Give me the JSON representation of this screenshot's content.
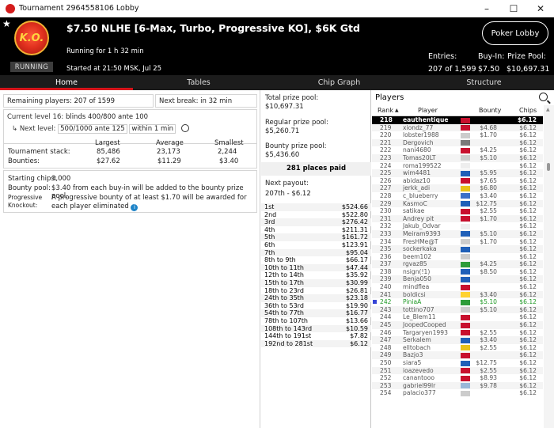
{
  "window": {
    "title": "Tournament 2964558106 Lobby"
  },
  "header": {
    "logo_text": "K.O.",
    "status_badge": "RUNNING",
    "title": "$7.50 NLHE [6-Max, Turbo, Progressive KO], $6K Gtd",
    "running_for": "Running for 1 h 32 min",
    "started_at": "Started at 21:50 MSK, Jul 25",
    "poker_lobby_label": "Poker Lobby",
    "entries_label": "Entries:",
    "entries_value": "207 of 1,599",
    "buyin_label": "Buy-In:",
    "buyin_value": "$7.50",
    "prizepool_label": "Prize Pool:",
    "prizepool_value": "$10,697.31"
  },
  "tabs": [
    "Home",
    "Tables",
    "Chip Graph",
    "Structure"
  ],
  "home": {
    "remaining": "Remaining players: 207 of 1599",
    "next_break": "Next break: in 32 min",
    "current_level_label": "Current level 16:",
    "current_level": "blinds 400/800 ante 100",
    "next_level_label": "Next level:",
    "next_level": "500/1000 ante 125",
    "next_level_time": "within 1 min",
    "stats_headers": [
      "Largest",
      "Average",
      "Smallest"
    ],
    "stack_label": "Tournament stack:",
    "stack": [
      "85,486",
      "23,173",
      "2,244"
    ],
    "bounty_label": "Bounties:",
    "bounty": [
      "$27.62",
      "$11.29",
      "$3.40"
    ],
    "starting_chips_label": "Starting chips:",
    "starting_chips": "3,000",
    "bounty_pool_label": "Bounty pool:",
    "bounty_pool": "$3.40 from each buy-in will be added to the bounty prize pool.",
    "progressive_label1": "Progressive",
    "progressive_label2": "Knockout:",
    "progressive_text": "A progressive bounty of at least $1.70 will be awarded for each player eliminated"
  },
  "prizes": {
    "total_label": "Total prize pool:",
    "total": "$10,697.31",
    "regular_label": "Regular prize pool:",
    "regular": "$5,260.71",
    "bounty_label": "Bounty prize pool:",
    "bounty": "$5,436.60",
    "places_paid": "281 places paid",
    "next_payout_label": "Next payout:",
    "next_payout": "207th - $6.12",
    "table": [
      [
        "1st",
        "$524.66"
      ],
      [
        "2nd",
        "$522.80"
      ],
      [
        "3rd",
        "$276.42"
      ],
      [
        "4th",
        "$211.31"
      ],
      [
        "5th",
        "$161.72"
      ],
      [
        "6th",
        "$123.91"
      ],
      [
        "7th",
        "$95.04"
      ],
      [
        "8th to 9th",
        "$66.17"
      ],
      [
        "10th to 11th",
        "$47.44"
      ],
      [
        "12th to 14th",
        "$35.92"
      ],
      [
        "15th to 17th",
        "$30.99"
      ],
      [
        "18th to 23rd",
        "$26.81"
      ],
      [
        "24th to 35th",
        "$23.18"
      ],
      [
        "36th to 53rd",
        "$19.90"
      ],
      [
        "54th to 77th",
        "$16.77"
      ],
      [
        "78th to 107th",
        "$13.66"
      ],
      [
        "108th to 143rd",
        "$10.59"
      ],
      [
        "144th to 191st",
        "$7.82"
      ],
      [
        "192nd to 281st",
        "$6.12"
      ]
    ]
  },
  "players": {
    "title": "Players",
    "columns": [
      "Rank",
      "Player",
      "Bounty",
      "Chips"
    ],
    "rows": [
      [
        "218",
        "eauthentique",
        "",
        "$6.12"
      ],
      [
        "219",
        "xiondz_77",
        "$4.68",
        "$6.12"
      ],
      [
        "220",
        "lobster1988",
        "$1.70",
        "$6.12"
      ],
      [
        "221",
        "Dergovich",
        "",
        "$6.12"
      ],
      [
        "222",
        "nani4680",
        "$4.25",
        "$6.12"
      ],
      [
        "223",
        "Tomas20LT",
        "$5.10",
        "$6.12"
      ],
      [
        "224",
        "roma199522",
        "",
        "$6.12"
      ],
      [
        "225",
        "wim4481",
        "$5.95",
        "$6.12"
      ],
      [
        "226",
        "abidaz10",
        "$7.65",
        "$6.12"
      ],
      [
        "227",
        "jerkk_adi",
        "$6.80",
        "$6.12"
      ],
      [
        "228",
        "c_blueberry",
        "$3.40",
        "$6.12"
      ],
      [
        "229",
        "KasmoC",
        "$12.75",
        "$6.12"
      ],
      [
        "230",
        "satikae",
        "$2.55",
        "$6.12"
      ],
      [
        "231",
        "Andrey pit",
        "$1.70",
        "$6.12"
      ],
      [
        "232",
        "Jakub_Odvar",
        "",
        "$6.12"
      ],
      [
        "233",
        "Meiram9393",
        "$5.10",
        "$6.12"
      ],
      [
        "234",
        "FresHMe@T",
        "$1.70",
        "$6.12"
      ],
      [
        "235",
        "sockerkaka",
        "",
        "$6.12"
      ],
      [
        "236",
        "beem102",
        "",
        "$6.12"
      ],
      [
        "237",
        "rgvaz85",
        "$4.25",
        "$6.12"
      ],
      [
        "238",
        "nsign(!1)",
        "$8.50",
        "$6.12"
      ],
      [
        "239",
        "Benja050",
        "",
        "$6.12"
      ],
      [
        "240",
        "mindflea",
        "",
        "$6.12"
      ],
      [
        "241",
        "boldicsi",
        "$3.40",
        "$6.12"
      ],
      [
        "242",
        "PiniaA",
        "$5.10",
        "$6.12"
      ],
      [
        "243",
        "tottino707",
        "$5.10",
        "$6.12"
      ],
      [
        "244",
        "Le_Blem11",
        "",
        "$6.12"
      ],
      [
        "245",
        "JoopedCooped",
        "",
        "$6.12"
      ],
      [
        "246",
        "Targaryen1993",
        "$2.55",
        "$6.12"
      ],
      [
        "247",
        "Serkalem",
        "$3.40",
        "$6.12"
      ],
      [
        "248",
        "elltobach",
        "$2.55",
        "$6.12"
      ],
      [
        "249",
        "Bazjo3",
        "",
        "$6.12"
      ],
      [
        "250",
        "siara5",
        "$12.75",
        "$6.12"
      ],
      [
        "251",
        "ioazevedo",
        "$2.55",
        "$6.12"
      ],
      [
        "252",
        "canantooo",
        "$8.93",
        "$6.12"
      ],
      [
        "253",
        "gabriel99lr",
        "$9.78",
        "$6.12"
      ],
      [
        "254",
        "palacio377",
        "",
        "$6.12"
      ]
    ],
    "flags": [
      "#c8102e",
      "#c8102e",
      "#cccccc",
      "#7a7a7a",
      "#c8102e",
      "#cccccc",
      "#eeeeee",
      "#1f5fb8",
      "#c8102e",
      "#e8c21a",
      "#3b6fc8",
      "#1f5fb8",
      "#c8102e",
      "#c8102e",
      "#eeeeee",
      "#1f5fb8",
      "#cccccc",
      "#1f5fb8",
      "#cccccc",
      "#2e9c3a",
      "#1f5fb8",
      "#1f5fb8",
      "#c8102e",
      "#ffd230",
      "#2e9c3a",
      "#cccccc",
      "#c8102e",
      "#c8102e",
      "#c8102e",
      "#1f5fb8",
      "#e8c21a",
      "#c8102e",
      "#1f5fb8",
      "#c8102e",
      "#c8102e",
      "#9ab8d8",
      "#cccccc"
    ],
    "selected_rank": "218",
    "highlight_rank": "242"
  },
  "colors": {
    "accent_red": "#d5151b",
    "header_bg": "#000000",
    "highlight_green": "#1f9a25"
  }
}
